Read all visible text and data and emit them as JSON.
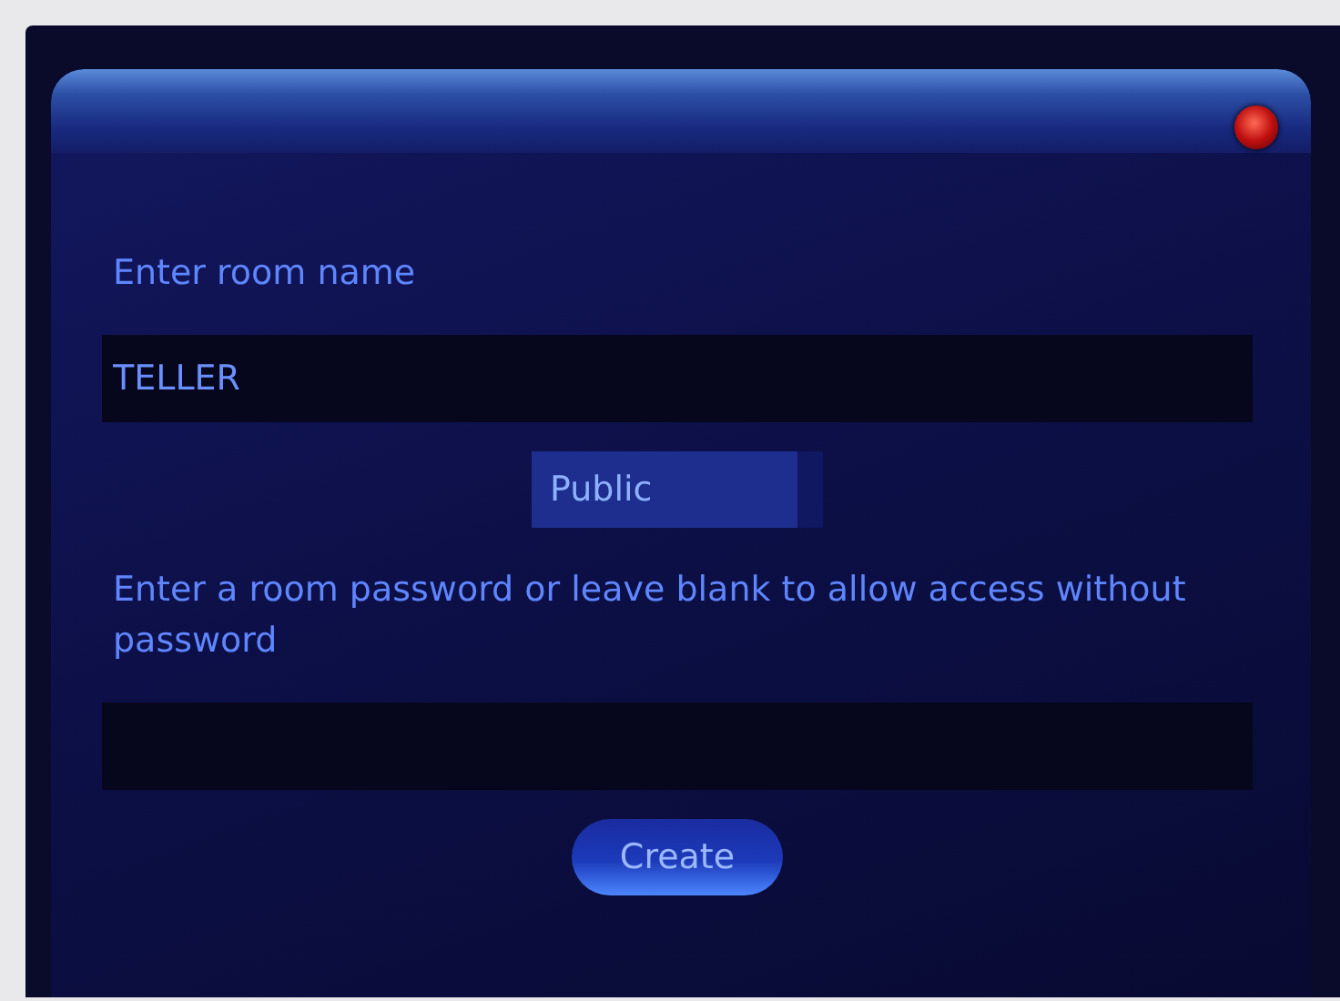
{
  "room_name": {
    "label": "Enter room name",
    "value": "TELLER"
  },
  "visibility": {
    "value": "Public"
  },
  "password": {
    "label": "Enter a room password or leave blank to allow access without password"
  },
  "buttons": [
    "Create"
  ]
}
